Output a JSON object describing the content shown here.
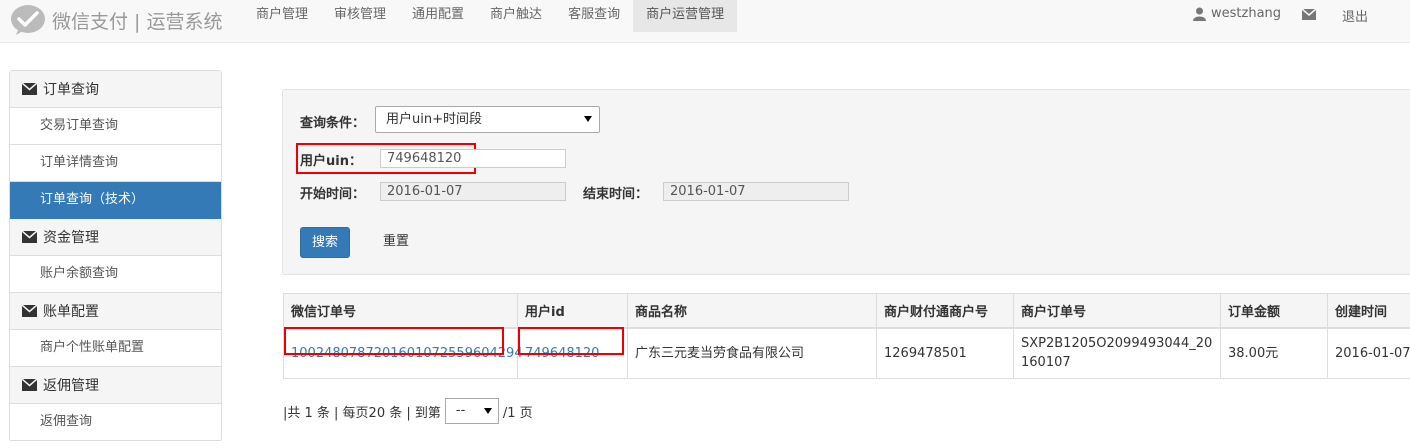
{
  "header": {
    "logo_text": "微信支付 | 运营系统",
    "nav": [
      {
        "label": "商户管理"
      },
      {
        "label": "审核管理"
      },
      {
        "label": "通用配置"
      },
      {
        "label": "商户触达"
      },
      {
        "label": "客服查询"
      },
      {
        "label": "商户运营管理"
      }
    ],
    "active_nav": "商户运营管理",
    "username": "westzhang",
    "logout_label": "退出"
  },
  "sidebar": {
    "groups": [
      {
        "title": "订单查询",
        "items": [
          "交易订单查询",
          "订单详情查询",
          "订单查询（技术）"
        ]
      },
      {
        "title": "资金管理",
        "items": [
          "账户余额查询"
        ]
      },
      {
        "title": "账单配置",
        "items": [
          "商户个性账单配置"
        ]
      },
      {
        "title": "返佣管理",
        "items": [
          "返佣查询"
        ]
      }
    ],
    "active_item": "订单查询（技术）"
  },
  "query": {
    "condition_label": "查询条件：",
    "condition_value": "用户uin+时间段",
    "uin_label": "用户uin：",
    "uin_value": "749648120",
    "start_label": "开始时间：",
    "start_value": "2016-01-07",
    "end_label": "结束时间：",
    "end_value": "2016-01-07",
    "search_label": "搜索",
    "reset_label": "重置"
  },
  "table": {
    "headers": [
      "微信订单号",
      "用户id",
      "商品名称",
      "商户财付通商户号",
      "商户订单号",
      "订单金额",
      "创建时间"
    ],
    "rows": [
      [
        "1002480787201601072559604294",
        "749648120",
        "广东三元麦当劳食品有限公司",
        "1269478501",
        "SXP2B1205O2099493044_20160107",
        "38.00元",
        "2016-01-07"
      ]
    ]
  },
  "pager": {
    "prefix": "|共 1 条 | 每页20 条 | 到第",
    "select_value": "--",
    "suffix": "/1 页"
  },
  "colors": {
    "primary": "#337ab7",
    "highlight": "#e00000"
  }
}
